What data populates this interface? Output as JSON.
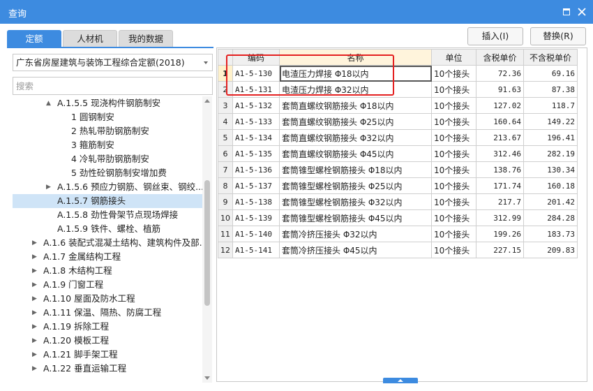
{
  "window": {
    "title": "查询"
  },
  "tabs": [
    {
      "label": "定额"
    },
    {
      "label": "人材机"
    },
    {
      "label": "我的数据"
    }
  ],
  "toolbar": {
    "insert_label": "插入(I)",
    "replace_label": "替换(R)"
  },
  "quota_select": {
    "value": "广东省房屋建筑与装饰工程综合定额(2018)"
  },
  "search": {
    "placeholder": "搜索"
  },
  "tree": {
    "items": [
      {
        "label": "A.1.5.5 现浇构件钢筋制安",
        "toggle": "▲"
      },
      {
        "label": "1 圆钢制安"
      },
      {
        "label": "2 热轧带肋钢筋制安"
      },
      {
        "label": "3 箍筋制安"
      },
      {
        "label": "4 冷轧带肋钢筋制安"
      },
      {
        "label": "5 劲性砼钢筋制安增加费"
      },
      {
        "label": "A.1.5.6 预应力钢筋、钢丝束、钢绞...",
        "toggle": "▶"
      },
      {
        "label": "A.1.5.7 钢筋接头"
      },
      {
        "label": "A.1.5.8 劲性骨架节点现场焊接"
      },
      {
        "label": "A.1.5.9 铁件、螺栓、植筋"
      },
      {
        "label": "A.1.6 装配式混凝土结构、建筑构件及部...",
        "toggle": "▶"
      },
      {
        "label": "A.1.7 金属结构工程",
        "toggle": "▶"
      },
      {
        "label": "A.1.8 木结构工程",
        "toggle": "▶"
      },
      {
        "label": "A.1.9 门窗工程",
        "toggle": "▶"
      },
      {
        "label": "A.1.10 屋面及防水工程",
        "toggle": "▶"
      },
      {
        "label": "A.1.11 保温、隔热、防腐工程",
        "toggle": "▶"
      },
      {
        "label": "A.1.19 拆除工程",
        "toggle": "▶"
      },
      {
        "label": "A.1.20 模板工程",
        "toggle": "▶"
      },
      {
        "label": "A.1.21 脚手架工程",
        "toggle": "▶"
      },
      {
        "label": "A.1.22 垂直运输工程",
        "toggle": "▶"
      }
    ]
  },
  "table": {
    "columns": [
      {
        "label": ""
      },
      {
        "label": "编码"
      },
      {
        "label": "名称"
      },
      {
        "label": "单位"
      },
      {
        "label": "含税单价"
      },
      {
        "label": "不含税单价"
      }
    ],
    "rows": [
      {
        "n": "1",
        "code": "A1-5-130",
        "name": "电渣压力焊接 Φ18以内",
        "unit": "10个接头",
        "tax": "72.36",
        "notax": "69.16"
      },
      {
        "n": "2",
        "code": "A1-5-131",
        "name": "电渣压力焊接 Φ32以内",
        "unit": "10个接头",
        "tax": "91.63",
        "notax": "87.38"
      },
      {
        "n": "3",
        "code": "A1-5-132",
        "name": "套筒直螺纹钢筋接头 Φ18以内",
        "unit": "10个接头",
        "tax": "127.02",
        "notax": "118.7"
      },
      {
        "n": "4",
        "code": "A1-5-133",
        "name": "套筒直螺纹钢筋接头 Φ25以内",
        "unit": "10个接头",
        "tax": "160.64",
        "notax": "149.22"
      },
      {
        "n": "5",
        "code": "A1-5-134",
        "name": "套筒直螺纹钢筋接头 Φ32以内",
        "unit": "10个接头",
        "tax": "213.67",
        "notax": "196.41"
      },
      {
        "n": "6",
        "code": "A1-5-135",
        "name": "套筒直螺纹钢筋接头 Φ45以内",
        "unit": "10个接头",
        "tax": "312.46",
        "notax": "282.19"
      },
      {
        "n": "7",
        "code": "A1-5-136",
        "name": "套筒锥型螺栓钢筋接头 Φ18以内",
        "unit": "10个接头",
        "tax": "138.76",
        "notax": "130.34"
      },
      {
        "n": "8",
        "code": "A1-5-137",
        "name": "套筒锥型螺栓钢筋接头 Φ25以内",
        "unit": "10个接头",
        "tax": "171.74",
        "notax": "160.18"
      },
      {
        "n": "9",
        "code": "A1-5-138",
        "name": "套筒锥型螺栓钢筋接头 Φ32以内",
        "unit": "10个接头",
        "tax": "217.7",
        "notax": "201.42"
      },
      {
        "n": "10",
        "code": "A1-5-139",
        "name": "套筒锥型螺栓钢筋接头 Φ45以内",
        "unit": "10个接头",
        "tax": "312.99",
        "notax": "284.28"
      },
      {
        "n": "11",
        "code": "A1-5-140",
        "name": "套筒冷挤压接头 Φ32以内",
        "unit": "10个接头",
        "tax": "199.26",
        "notax": "183.73"
      },
      {
        "n": "12",
        "code": "A1-5-141",
        "name": "套筒冷挤压接头 Φ45以内",
        "unit": "10个接头",
        "tax": "227.15",
        "notax": "209.83"
      }
    ]
  },
  "colors": {
    "accent": "#3d8be0",
    "highlight": "#e42020",
    "selected_row": "#cfe4f7"
  }
}
